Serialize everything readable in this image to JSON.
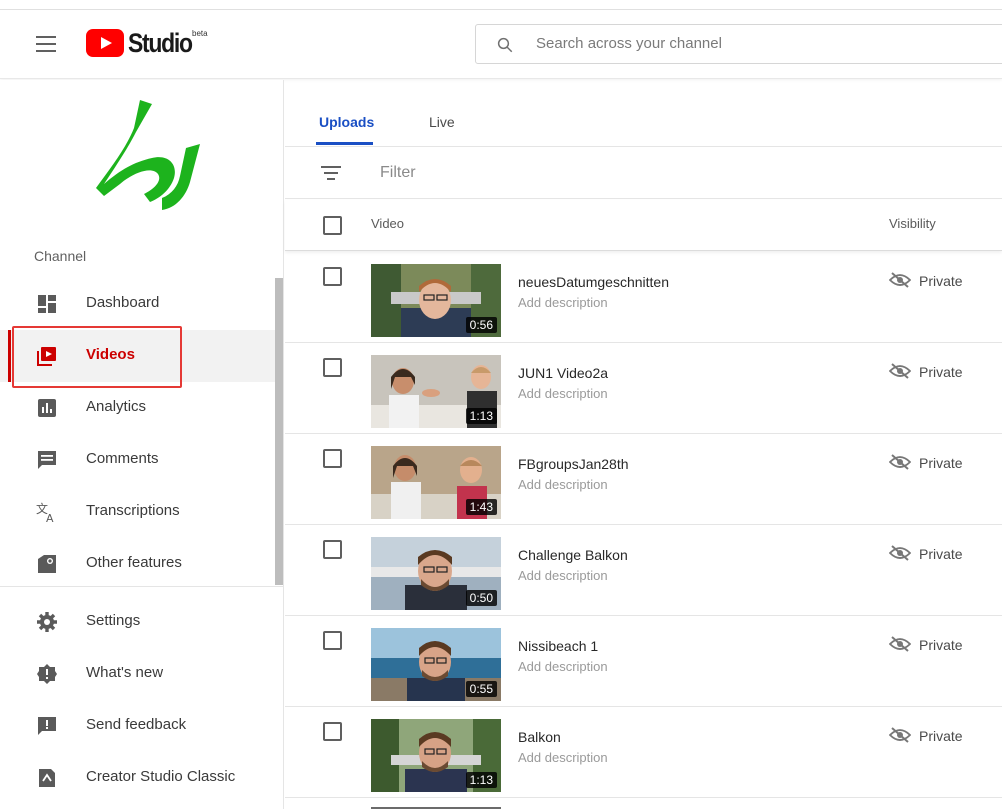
{
  "header": {
    "logo_text": "Studio",
    "beta": "beta",
    "search_placeholder": "Search across your channel"
  },
  "sidebar": {
    "section_label": "Channel",
    "items": [
      {
        "label": "Dashboard",
        "icon": "dashboard-icon",
        "active": false
      },
      {
        "label": "Videos",
        "icon": "videos-icon",
        "active": true
      },
      {
        "label": "Analytics",
        "icon": "analytics-icon",
        "active": false
      },
      {
        "label": "Comments",
        "icon": "comments-icon",
        "active": false
      },
      {
        "label": "Transcriptions",
        "icon": "transcriptions-icon",
        "active": false
      },
      {
        "label": "Other features",
        "icon": "other-features-icon",
        "active": false
      }
    ],
    "bottom_items": [
      {
        "label": "Settings",
        "icon": "settings-icon"
      },
      {
        "label": "What's new",
        "icon": "whats-new-icon"
      },
      {
        "label": "Send feedback",
        "icon": "feedback-icon"
      },
      {
        "label": "Creator Studio Classic",
        "icon": "creator-studio-classic-icon"
      }
    ]
  },
  "main": {
    "tabs": [
      {
        "label": "Uploads",
        "active": true
      },
      {
        "label": "Live",
        "active": false
      }
    ],
    "filter_label": "Filter",
    "columns": {
      "video": "Video",
      "visibility": "Visibility"
    },
    "videos": [
      {
        "title": "neuesDatumgeschnitten",
        "description": "Add description",
        "duration": "0:56",
        "visibility": "Private"
      },
      {
        "title": "JUN1 Video2a",
        "description": "Add description",
        "duration": "1:13",
        "visibility": "Private"
      },
      {
        "title": "FBgroupsJan28th",
        "description": "Add description",
        "duration": "1:43",
        "visibility": "Private"
      },
      {
        "title": "Challenge Balkon",
        "description": "Add description",
        "duration": "0:50",
        "visibility": "Private"
      },
      {
        "title": "Nissibeach 1",
        "description": "Add description",
        "duration": "0:55",
        "visibility": "Private"
      },
      {
        "title": "Balkon",
        "description": "Add description",
        "duration": "1:13",
        "visibility": "Private"
      }
    ]
  },
  "colors": {
    "accent_red": "#cc0000",
    "tab_blue": "#1a4fc4",
    "logo_green": "#1db31d"
  }
}
